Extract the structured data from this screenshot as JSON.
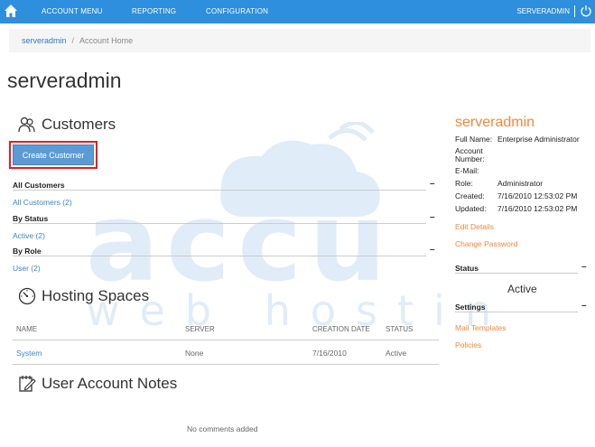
{
  "nav": {
    "items": [
      "ACCOUNT MENU",
      "REPORTING",
      "CONFIGURATION"
    ],
    "user": "SERVERADMIN"
  },
  "breadcrumb": {
    "link": "serveradmin",
    "separator": "/",
    "current": "Account Home"
  },
  "page_title": "serveradmin",
  "watermark": {
    "brand": "accu",
    "tagline": "web hosting"
  },
  "customers": {
    "heading": "Customers",
    "create_button": "Create Customer",
    "groups": [
      {
        "title": "All Customers",
        "collapse": "–",
        "link": "All Customers (2)"
      },
      {
        "title": "By Status",
        "collapse": "–",
        "link": "Active (2)"
      },
      {
        "title": "By Role",
        "collapse": "–",
        "link": "User (2)"
      }
    ]
  },
  "hosting": {
    "heading": "Hosting Spaces",
    "columns": [
      "NAME",
      "SERVER",
      "CREATION DATE",
      "STATUS"
    ],
    "rows": [
      {
        "name": "System",
        "server": "None",
        "date": "7/16/2010",
        "status": "Active"
      }
    ]
  },
  "notes": {
    "heading": "User Account Notes",
    "empty": "No comments added"
  },
  "account": {
    "title": "serveradmin",
    "fields": [
      {
        "label": "Full Name:",
        "value": "Enterprise Administrator"
      },
      {
        "label": "Account Number:",
        "value": ""
      },
      {
        "label": "E-Mail:",
        "value": ""
      },
      {
        "label": "Role:",
        "value": "Administrator"
      },
      {
        "label": "Created:",
        "value": "7/16/2010 12:53:02 PM"
      },
      {
        "label": "Updated:",
        "value": "7/16/2010 12:53:02 PM"
      }
    ],
    "edit_details": "Edit Details",
    "change_password": "Change Password",
    "status_heading": "Status",
    "status_collapse": "–",
    "status_value": "Active",
    "settings_heading": "Settings",
    "settings_collapse": "–",
    "settings_links": [
      "Mail Templates",
      "Policies"
    ]
  },
  "colors": {
    "nav": "#2d8fdd",
    "link": "#3a87c8",
    "accent": "#f0883a",
    "highlight": "#e02020"
  }
}
